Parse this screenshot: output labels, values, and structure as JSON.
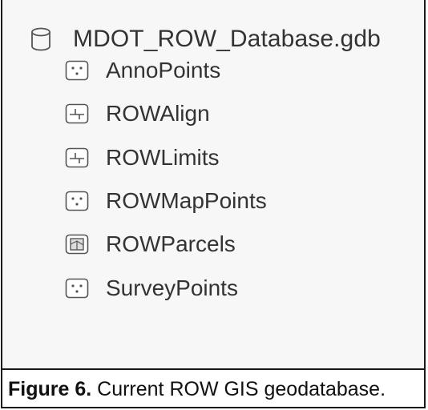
{
  "tree": {
    "root": {
      "label": "MDOT_ROW_Database.gdb",
      "icon": "geodatabase-icon"
    },
    "items": [
      {
        "label": "AnnoPoints",
        "icon": "point-feature-class-icon"
      },
      {
        "label": "ROWAlign",
        "icon": "line-feature-class-icon"
      },
      {
        "label": "ROWLimits",
        "icon": "line-feature-class-icon"
      },
      {
        "label": "ROWMapPoints",
        "icon": "point-feature-class-icon"
      },
      {
        "label": "ROWParcels",
        "icon": "polygon-feature-class-icon"
      },
      {
        "label": "SurveyPoints",
        "icon": "point-feature-class-icon"
      }
    ]
  },
  "caption": {
    "label": "Figure 6.",
    "text": " Current ROW GIS geodatabase."
  }
}
